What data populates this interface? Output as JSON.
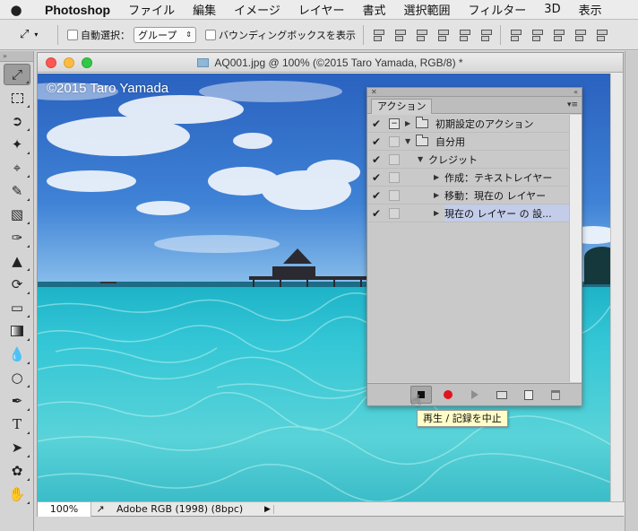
{
  "menubar": {
    "apple_glyph": "",
    "app_name": "Photoshop",
    "items": [
      "ファイル",
      "編集",
      "イメージ",
      "レイヤー",
      "書式",
      "選択範囲",
      "フィルター",
      "3D",
      "表示"
    ]
  },
  "options": {
    "auto_select_label": "自動選択：",
    "auto_select_value": "グループ",
    "bounding_box_label": "バウンディングボックスを表示"
  },
  "tools": [
    "move",
    "marquee",
    "lasso",
    "magic-wand",
    "crop",
    "eyedropper",
    "healing",
    "brush",
    "stamp",
    "history-brush",
    "eraser",
    "gradient",
    "blur",
    "dodge",
    "pen",
    "type",
    "path-select",
    "shape",
    "hand"
  ],
  "document": {
    "title": "AQ001.jpg @ 100% (©2015 Taro Yamada, RGB/8) *",
    "watermark": "©2015 Taro Yamada",
    "zoom": "100%",
    "color_profile": "Adobe RGB (1998) (8bpc)"
  },
  "actions_panel": {
    "tab_label": "アクション",
    "rows": [
      {
        "label": "初期設定のアクション",
        "checked": true,
        "dialog": true,
        "folder": true,
        "expanded": false,
        "indent": 0,
        "selected": false
      },
      {
        "label": "自分用",
        "checked": true,
        "dialog": false,
        "folder": true,
        "expanded": true,
        "indent": 0,
        "selected": false
      },
      {
        "label": "クレジット",
        "checked": true,
        "dialog": false,
        "folder": false,
        "expanded": true,
        "indent": 1,
        "selected": false
      },
      {
        "label": "作成：テキストレイヤー",
        "checked": true,
        "dialog": false,
        "folder": false,
        "expanded": false,
        "indent": 2,
        "selected": false
      },
      {
        "label": "移動：現在の レイヤー",
        "checked": true,
        "dialog": false,
        "folder": false,
        "expanded": false,
        "indent": 2,
        "selected": false
      },
      {
        "label": "現在の レイヤー の 設...",
        "checked": true,
        "dialog": false,
        "folder": false,
        "expanded": false,
        "indent": 2,
        "selected": true
      }
    ]
  },
  "tooltip": "再生 / 記録を中止",
  "colors": {
    "record_red": "#e0141f",
    "selection_blue": "#c3cce8",
    "sky": "#2f6fc8",
    "water": "#33c3d6"
  }
}
